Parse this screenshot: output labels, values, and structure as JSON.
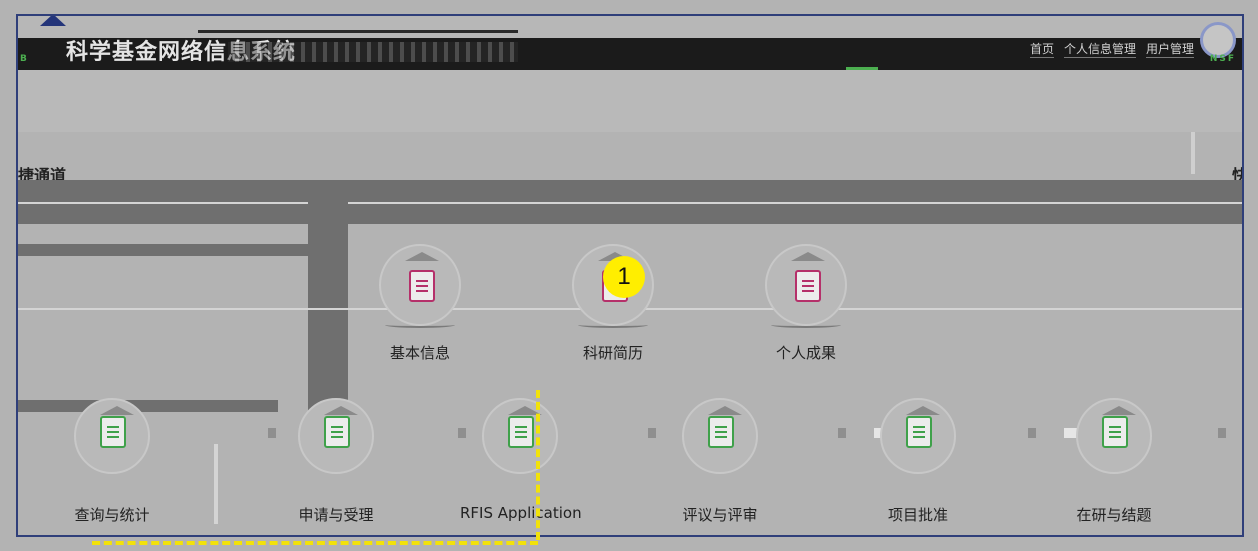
{
  "header": {
    "system_title": "科学基金网络信息系统",
    "links": [
      "首页",
      "个人信息管理",
      "用户管理"
    ],
    "nsf_mark": "NSF"
  },
  "panel": {
    "section_title": "捷通道",
    "section_title_right": "快"
  },
  "quick_row": [
    {
      "label": "基本信息",
      "icon": "document-icon"
    },
    {
      "label": "科研简历",
      "icon": "document-list-icon"
    },
    {
      "label": "个人成果",
      "icon": "document-icon"
    }
  ],
  "module_row": [
    {
      "label": "查询与统计",
      "icon": "document-green-icon"
    },
    {
      "label": "申请与受理",
      "icon": "document-green-icon"
    },
    {
      "label": "RFIS Application",
      "icon": "document-green-icon"
    },
    {
      "label": "评议与评审",
      "icon": "document-green-icon"
    },
    {
      "label": "项目批准",
      "icon": "document-green-icon"
    },
    {
      "label": "在研与结题",
      "icon": "folder-icon"
    }
  ],
  "annotation": {
    "badge": "1"
  },
  "colors": {
    "frame": "#2f3f7a",
    "accent_green": "#4caf50",
    "doc_pink": "#b5306a",
    "badge_yellow": "#ffee00"
  }
}
